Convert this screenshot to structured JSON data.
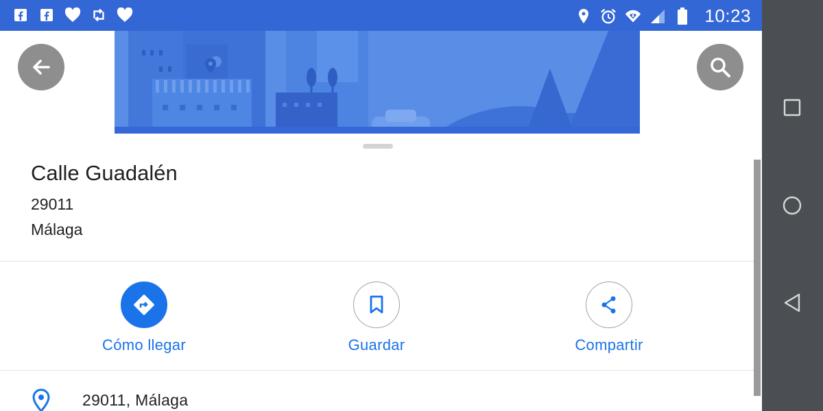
{
  "status_bar": {
    "left_icons": [
      "facebook-icon",
      "facebook-icon",
      "heart-icon",
      "retweet-icon",
      "heart-icon"
    ],
    "right_icons": [
      "location-icon",
      "alarm-icon",
      "wifi-icon",
      "signal-icon",
      "battery-icon"
    ],
    "clock": "10:23",
    "color": "#3367d6"
  },
  "top_buttons": {
    "back_icon": "arrow-back-icon",
    "search_icon": "search-icon"
  },
  "place": {
    "title": "Calle Guadalén",
    "postal_code": "29011",
    "city": "Málaga"
  },
  "actions": [
    {
      "label": "Cómo llegar",
      "icon": "directions-icon"
    },
    {
      "label": "Guardar",
      "icon": "bookmark-icon"
    },
    {
      "label": "Compartir",
      "icon": "share-icon"
    }
  ],
  "address_row": {
    "icon": "location-pin-icon",
    "text": "29011, Málaga"
  },
  "nav_bar": {
    "buttons": [
      "recents-icon",
      "home-icon",
      "back-icon"
    ]
  },
  "colors": {
    "accent": "#1a73e8",
    "banner": "#4a7fe0",
    "fab": "#8e8e8e",
    "nav": "#4b4f53"
  }
}
